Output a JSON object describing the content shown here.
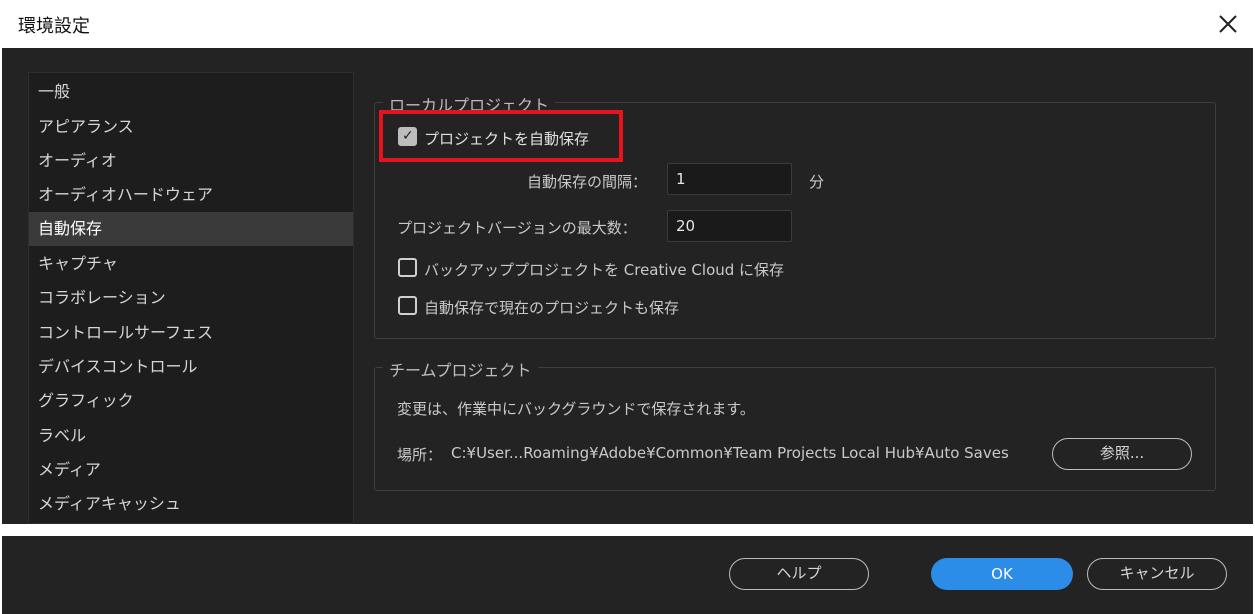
{
  "window": {
    "title": "環境設定",
    "close_icon": "close-icon"
  },
  "sidebar": {
    "items": [
      {
        "label": "一般"
      },
      {
        "label": "アピアランス"
      },
      {
        "label": "オーディオ"
      },
      {
        "label": "オーディオハードウェア"
      },
      {
        "label": "自動保存",
        "selected": true
      },
      {
        "label": "キャプチャ"
      },
      {
        "label": "コラボレーション"
      },
      {
        "label": "コントロールサーフェス"
      },
      {
        "label": "デバイスコントロール"
      },
      {
        "label": "グラフィック"
      },
      {
        "label": "ラベル"
      },
      {
        "label": "メディア"
      },
      {
        "label": "メディアキャッシュ"
      }
    ]
  },
  "local_project": {
    "legend": "ローカルプロジェクト",
    "autosave_checkbox": {
      "label": "プロジェクトを自動保存",
      "checked": true
    },
    "interval": {
      "label": "自動保存の間隔：",
      "value": "1",
      "unit": "分"
    },
    "max_versions": {
      "label": "プロジェクトバージョンの最大数：",
      "value": "20"
    },
    "backup_checkbox": {
      "label": "バックアッププロジェクトを Creative Cloud に保存",
      "checked": false
    },
    "current_checkbox": {
      "label": "自動保存で現在のプロジェクトも保存",
      "checked": false
    }
  },
  "team_project": {
    "legend": "チームプロジェクト",
    "description": "変更は、作業中にバックグラウンドで保存されます。",
    "location_label": "場所：",
    "location_path": "C:¥User...Roaming¥Adobe¥Common¥Team Projects Local Hub¥Auto Saves",
    "browse_label": "参照..."
  },
  "footer": {
    "help_label": "ヘルプ",
    "ok_label": "OK",
    "cancel_label": "キャンセル"
  },
  "colors": {
    "background": "#232323",
    "accent": "#2b8de8",
    "highlight": "#e5141c"
  }
}
